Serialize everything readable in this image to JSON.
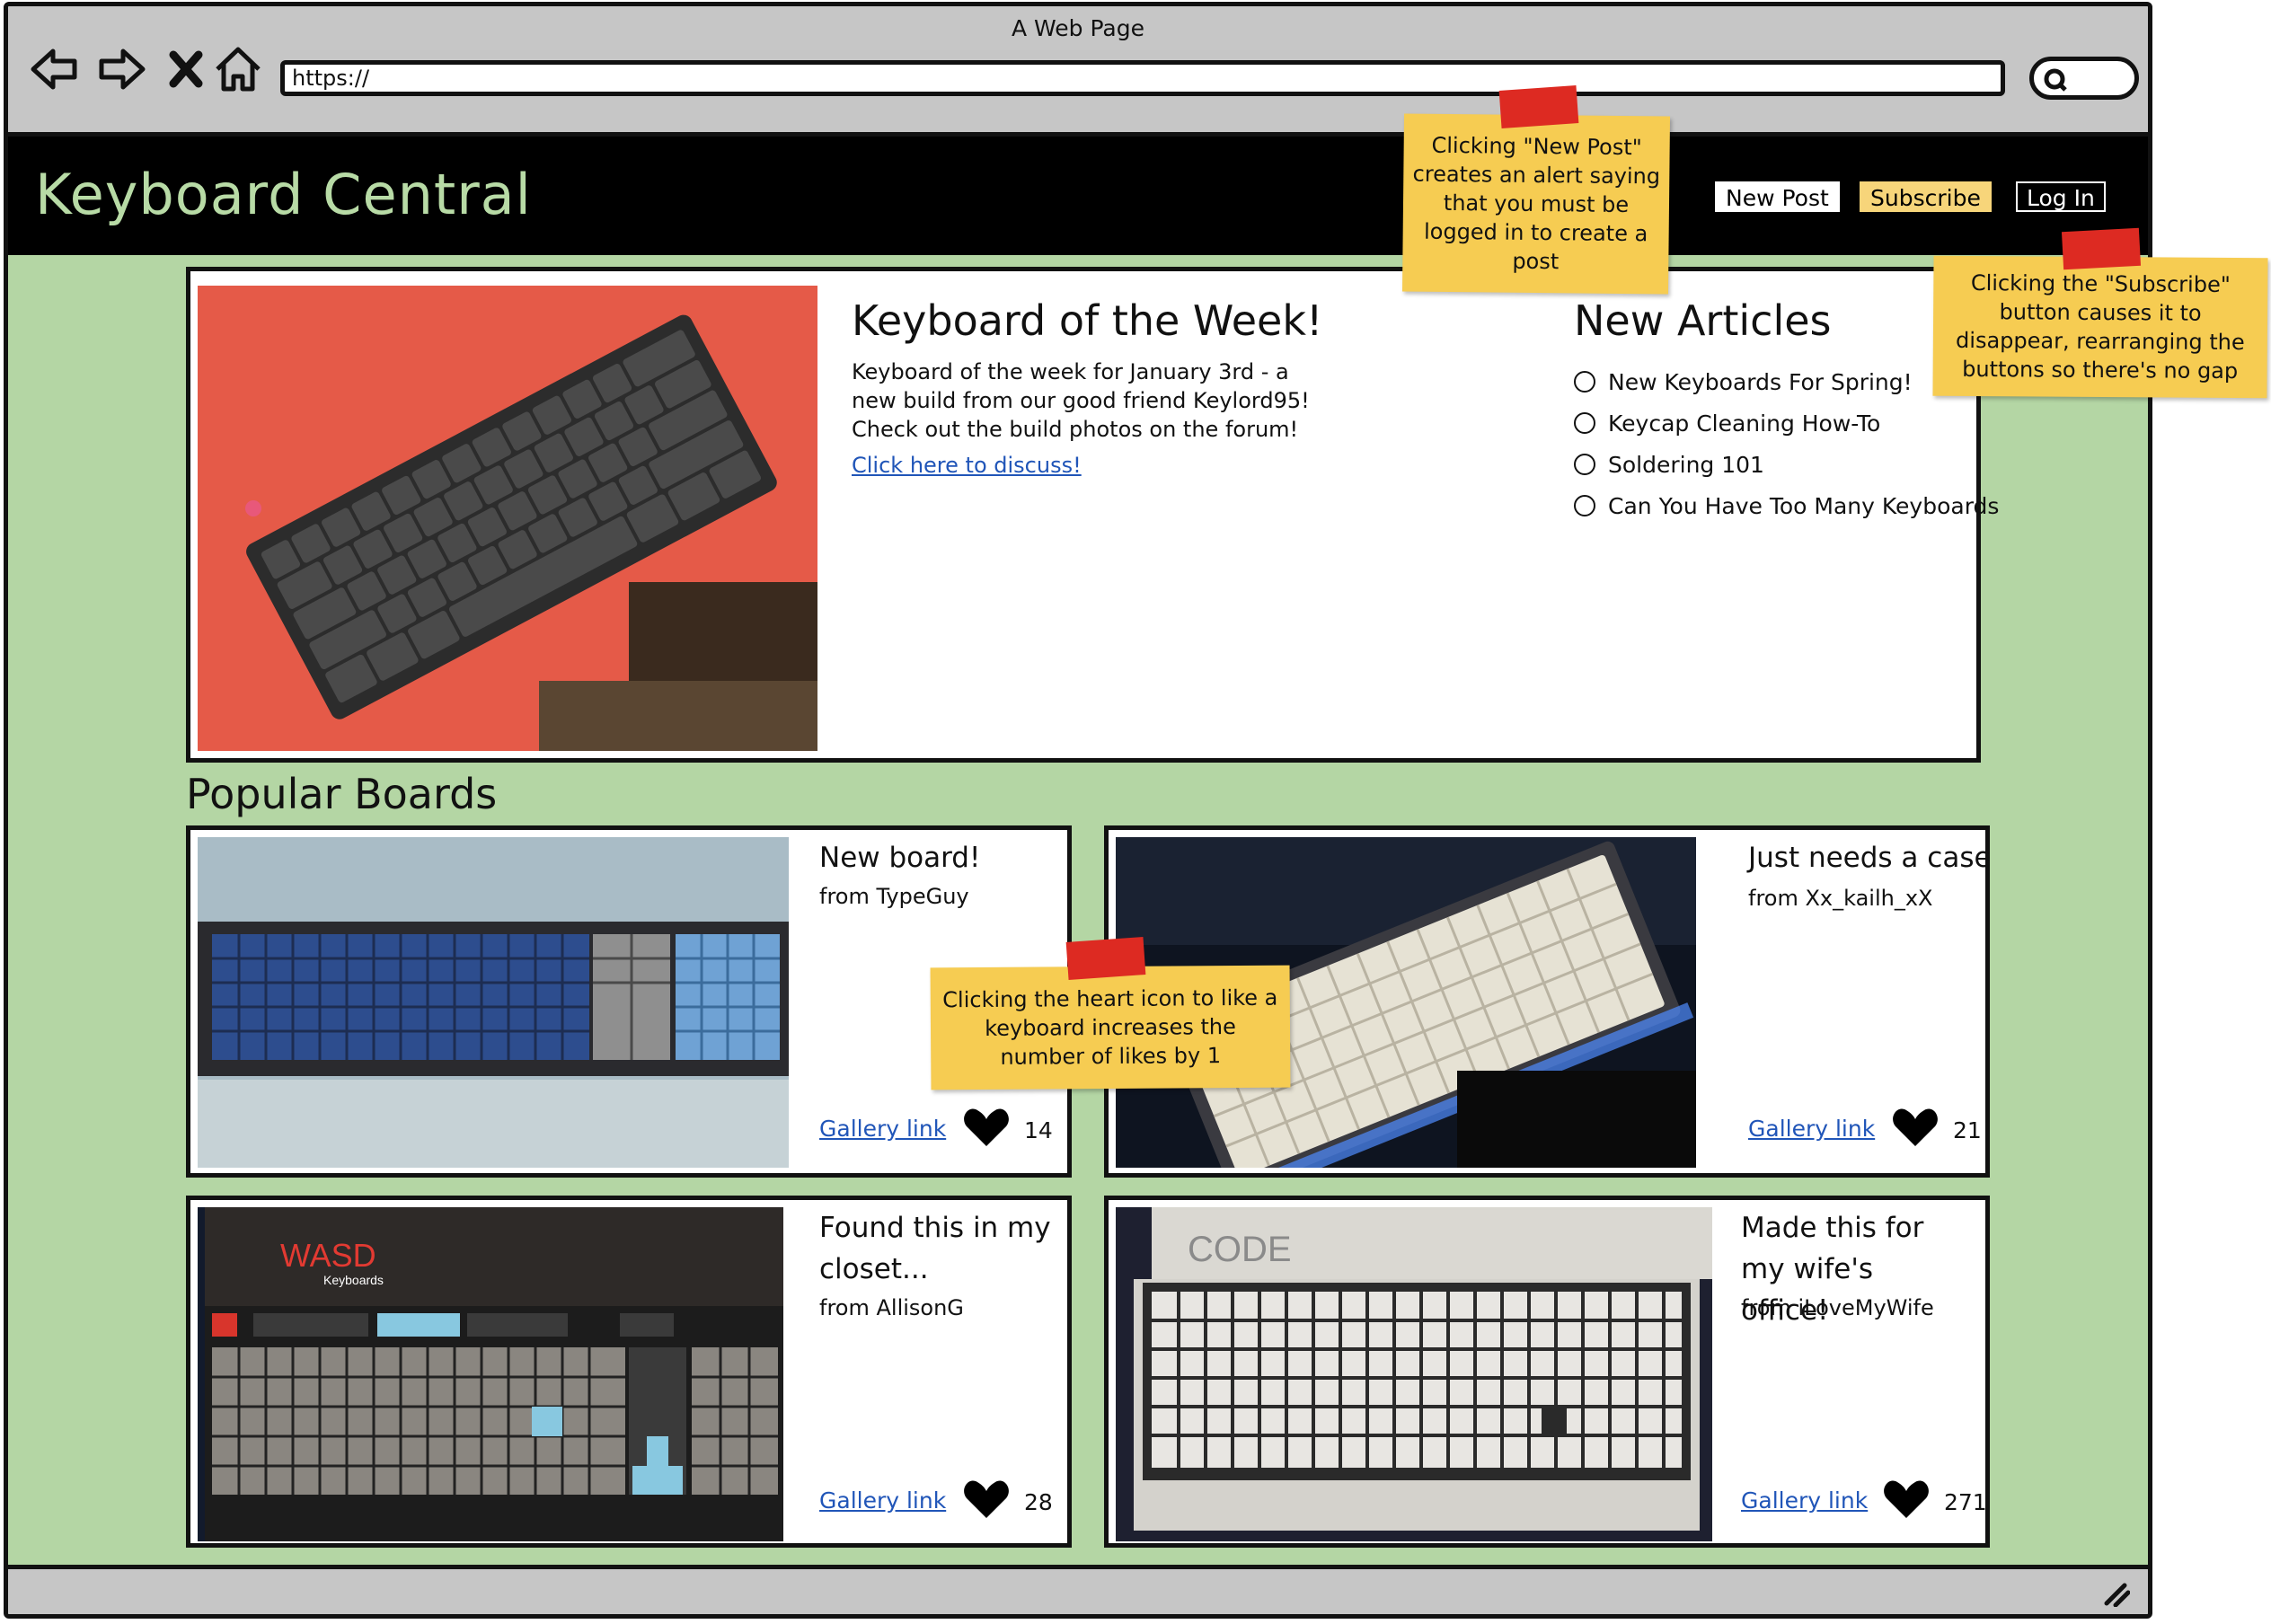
{
  "browser": {
    "window_title": "A Web Page",
    "url": "https://",
    "icons": [
      "back-arrow-icon",
      "forward-arrow-icon",
      "stop-x-icon",
      "home-icon",
      "search-icon"
    ]
  },
  "site": {
    "title": "Keyboard Central",
    "title_color": "#b8dba6",
    "background": "#b4d6a4",
    "nav": {
      "new_post": "New Post",
      "subscribe": "Subscribe",
      "log_in": "Log In"
    }
  },
  "hero": {
    "heading": "Keyboard of the Week!",
    "body": "Keyboard of the week for January 3rd - a new build from our good friend Keylord95! Check out the build photos on the forum!",
    "link": "Click here to discuss!"
  },
  "articles": {
    "heading": "New Articles",
    "items": [
      {
        "label": "New Keyboards For Spring!"
      },
      {
        "label": "Keycap Cleaning How-To"
      },
      {
        "label": "Soldering 101"
      },
      {
        "label": "Can You Have Too Many Keyboards"
      }
    ]
  },
  "popular": {
    "heading": "Popular Boards",
    "cards": [
      {
        "title": "New board!",
        "author": "from TypeGuy",
        "link": "Gallery link",
        "likes": "14"
      },
      {
        "title": "Just needs a case",
        "author": "from Xx_kailh_xX",
        "link": "Gallery link",
        "likes": "21"
      },
      {
        "title": "Found this in my closet...",
        "author": "from AllisonG",
        "link": "Gallery link",
        "likes": "28",
        "photo_text": {
          "brand": "WASD",
          "sub": "Keyboards"
        }
      },
      {
        "title": "Made this for my wife's office!",
        "author": "from iLoveMyWife",
        "link": "Gallery link",
        "likes": "271",
        "photo_text": {
          "box": "CODE"
        }
      }
    ]
  },
  "notes": {
    "new_post": "Clicking \"New Post\" creates an alert saying that you must be logged in to create a post",
    "subscribe": "Clicking the \"Subscribe\" button causes it to disappear, rearranging the buttons so there's no gap",
    "heart": "Clicking the heart icon to like a keyboard increases the number of likes by 1"
  },
  "colors": {
    "note": "#f6cc52",
    "tape": "#dd2a22",
    "link": "#2055b8",
    "subscribe_button": "#f7d57a"
  }
}
